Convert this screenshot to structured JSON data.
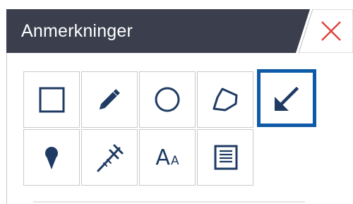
{
  "panel": {
    "title": "Anmerkninger"
  },
  "colors": {
    "titlebar": "#3a3e4d",
    "icon": "#1f3b63",
    "active_border": "#0f5aa8",
    "close_icon": "#e0413a",
    "tile_border": "#c9c9c9"
  },
  "tools": [
    {
      "icon": "rectangle-icon",
      "active": false
    },
    {
      "icon": "pencil-icon",
      "active": false
    },
    {
      "icon": "circle-icon",
      "active": false
    },
    {
      "icon": "polygon-icon",
      "active": false
    },
    {
      "icon": "arrow-icon",
      "active": true
    },
    {
      "icon": "pin-icon",
      "active": false
    },
    {
      "icon": "caliper-icon",
      "active": false
    },
    {
      "icon": "text-icon",
      "active": false,
      "label_big": "A",
      "label_small": "A"
    },
    {
      "icon": "note-icon",
      "active": false
    }
  ]
}
